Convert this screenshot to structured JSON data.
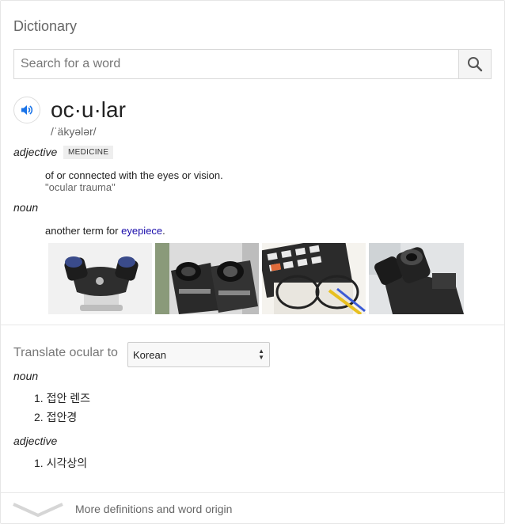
{
  "dictionary": {
    "title": "Dictionary",
    "search_placeholder": "Search for a word",
    "headword": "oc·u·lar",
    "phonetic": "/ˈäkyələr/",
    "senses": [
      {
        "pos": "adjective",
        "label": "MEDICINE",
        "definition": "of or connected with the eyes or vision.",
        "example": "\"ocular trauma\""
      },
      {
        "pos": "noun",
        "definition_prefix": "another term for ",
        "definition_link": "eyepiece",
        "definition_suffix": "."
      }
    ],
    "images": [
      {
        "icon": "microscope-eyepieces-image"
      },
      {
        "icon": "binocular-eyepiece-closeup-image"
      },
      {
        "icon": "glasses-on-calculator-image"
      },
      {
        "icon": "microscope-head-image"
      }
    ]
  },
  "translate": {
    "label": "Translate ocular to",
    "selected_language": "Korean",
    "groups": [
      {
        "pos": "noun",
        "items": [
          "1. 접안 렌즈",
          "2. 접안경"
        ]
      },
      {
        "pos": "adjective",
        "items": [
          "1. 시각상의"
        ]
      }
    ]
  },
  "footer": {
    "more_label": "More definitions and word origin"
  },
  "colors": {
    "link": "#1a0dab",
    "audio_icon": "#1a73e8",
    "muted_text": "#666666"
  }
}
